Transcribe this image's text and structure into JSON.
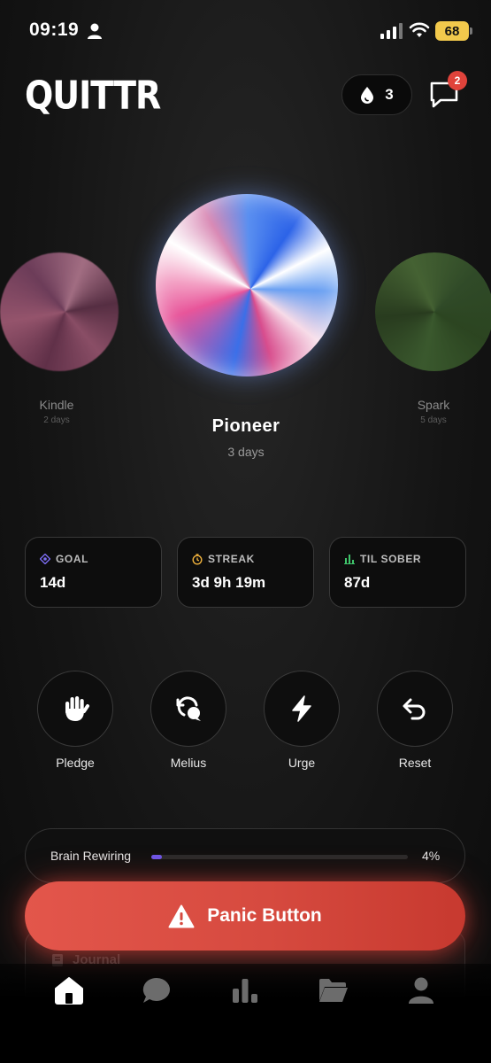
{
  "status_bar": {
    "time": "09:19",
    "battery": "68"
  },
  "header": {
    "logo": "QUITTR",
    "streak_count": "3",
    "notification_count": "2"
  },
  "orbs": {
    "left": {
      "name": "Kindle",
      "days": "2 days",
      "color": "#b0607f"
    },
    "center": {
      "name": "Pioneer",
      "days": "3 days"
    },
    "right": {
      "name": "Spark",
      "days": "5 days",
      "color": "#3e6030"
    }
  },
  "stats": [
    {
      "label": "GOAL",
      "value": "14d",
      "icon": "target-icon",
      "icon_color": "#7b6cf0"
    },
    {
      "label": "STREAK",
      "value": "3d 9h 19m",
      "icon": "timer-icon",
      "icon_color": "#f0b23c"
    },
    {
      "label": "TIL SOBER",
      "value": "87d",
      "icon": "bar-chart-icon",
      "icon_color": "#3fc46b"
    }
  ],
  "actions": [
    {
      "label": "Pledge",
      "icon": "hand-icon"
    },
    {
      "label": "Melius",
      "icon": "chat-refresh-icon"
    },
    {
      "label": "Urge",
      "icon": "lightning-icon"
    },
    {
      "label": "Reset",
      "icon": "undo-icon"
    }
  ],
  "brain_rewiring": {
    "label": "Brain Rewiring",
    "percent_text": "4%",
    "progress": 0.04,
    "color": "#6d56e8"
  },
  "panic": {
    "label": "Panic Button",
    "color": "#d64a3f"
  },
  "journal": {
    "label": "Journal"
  },
  "nav": [
    {
      "name": "home",
      "icon": "home-icon",
      "active": true
    },
    {
      "name": "chat",
      "icon": "chat-bubble-icon",
      "active": false
    },
    {
      "name": "stats",
      "icon": "bar-chart-icon",
      "active": false
    },
    {
      "name": "library",
      "icon": "folder-icon",
      "active": false
    },
    {
      "name": "profile",
      "icon": "user-icon",
      "active": false
    }
  ]
}
